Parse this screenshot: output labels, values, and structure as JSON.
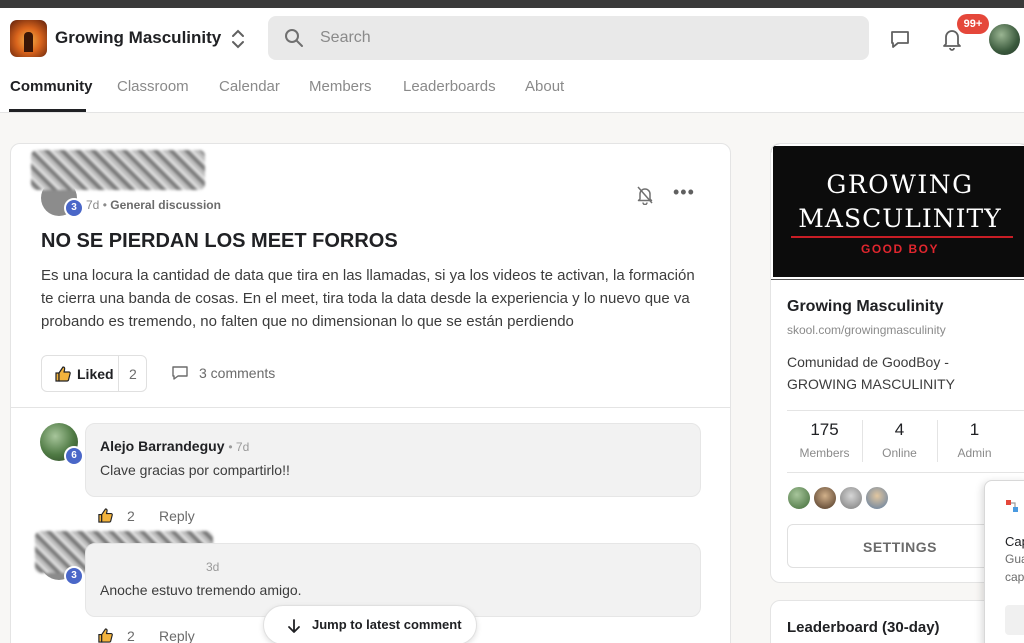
{
  "app": {
    "title": "Growing Masculinity",
    "search_placeholder": "Search",
    "notifications_badge": "99+"
  },
  "tabs": [
    {
      "label": "Community",
      "active": true
    },
    {
      "label": "Classroom"
    },
    {
      "label": "Calendar"
    },
    {
      "label": "Members"
    },
    {
      "label": "Leaderboards"
    },
    {
      "label": "About"
    }
  ],
  "post": {
    "author_level": "3",
    "age": "7d",
    "category": "General discussion",
    "title": "NO SE PIERDAN LOS MEET FORROS",
    "body": "Es una locura la cantidad de data que tira en las llamadas, si ya los videos te activan, la formación te cierra una banda de cosas. En el meet, tira toda la data desde la experiencia y lo nuevo que va probando es tremendo, no falten que no dimensionan lo que se están perdiendo",
    "liked_label": "Liked",
    "like_count": "2",
    "comments_label": "3 comments"
  },
  "comments": [
    {
      "author": "Alejo Barrandeguy",
      "time": "7d",
      "level": "6",
      "text": "Clave gracias por compartirlo!!",
      "likes": "2",
      "reply_label": "Reply"
    },
    {
      "time": "3d",
      "level": "3",
      "text": "Anoche estuvo tremendo amigo.",
      "likes": "2",
      "reply_label": "Reply"
    }
  ],
  "jump_button": "Jump to latest comment",
  "group": {
    "banner_line1": "GROWING",
    "banner_line2": "MASCULINITY",
    "banner_line3": "GOOD BOY",
    "name": "Growing Masculinity",
    "url": "skool.com/growingmasculinity",
    "description": "Comunidad de GoodBoy - GROWING MASCULINITY",
    "stats": [
      {
        "value": "175",
        "label": "Members"
      },
      {
        "value": "4",
        "label": "Online"
      },
      {
        "value": "1",
        "label": "Admin"
      }
    ],
    "settings_label": "SETTINGS"
  },
  "leaderboard_title": "Leaderboard (30-day)",
  "popup": {
    "line1": "Cap",
    "line2": "Gua",
    "line3": "cap"
  },
  "colors": {
    "accent_red": "#e5473a",
    "level_blue": "#4a67c8",
    "banner_red": "#c81d25"
  }
}
